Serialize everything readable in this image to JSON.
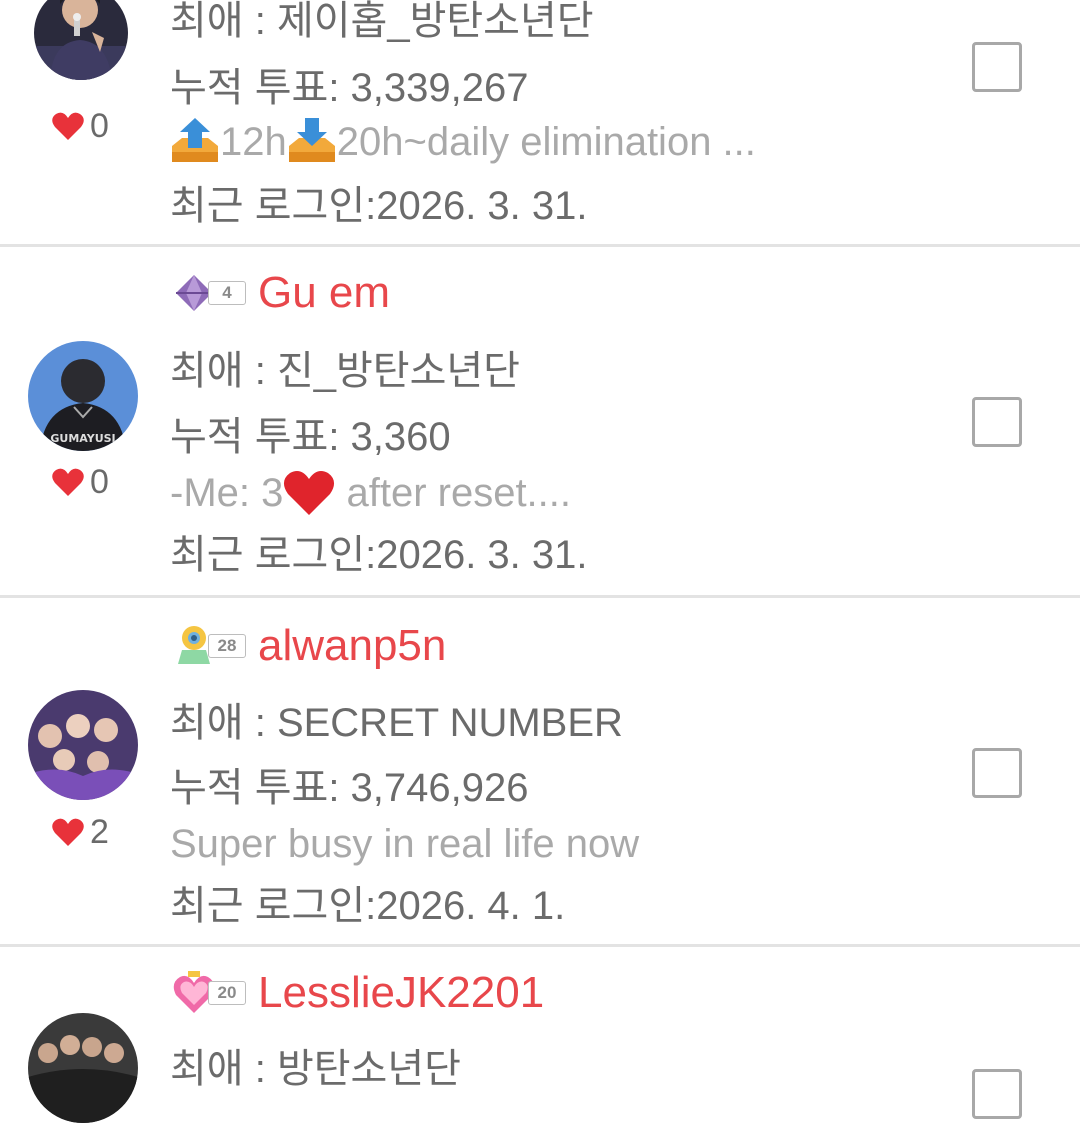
{
  "entries": [
    {
      "username": "",
      "level": "",
      "fav_line": "최애 : 제이홉_방탄소년단",
      "votes_line": "누적 투표: 3,339,267",
      "status_parts": [
        "12h",
        "20h~daily elimination ..."
      ],
      "login_line": "최근 로그인:2026. 3. 31.",
      "likes": "0",
      "checked": false,
      "avatar_icon": "avatar-singer-icon"
    },
    {
      "username": "Gu em",
      "level": "4",
      "badge_icon": "purple-gem-icon",
      "fav_line": "최애 : 진_방탄소년단",
      "votes_line": "누적 투표: 3,360",
      "status_parts": [
        "-Me: 3",
        " after reset...."
      ],
      "login_line": "최근 로그인:2026. 3. 31.",
      "likes": "0",
      "checked": false,
      "avatar_icon": "avatar-gumayusi-icon"
    },
    {
      "username": "alwanp5n",
      "level": "28",
      "badge_icon": "sunflower-crown-icon",
      "fav_line": "최애 : SECRET NUMBER",
      "votes_line": "누적 투표: 3,746,926",
      "status": "Super busy in real life now",
      "login_line": "최근 로그인:2026. 4. 1.",
      "likes": "2",
      "checked": false,
      "avatar_icon": "avatar-group-photo-icon"
    },
    {
      "username": "LesslieJK2201",
      "level": "20",
      "badge_icon": "pink-heart-badge-icon",
      "fav_line": "최애 : 방탄소년단",
      "checked": false,
      "avatar_icon": "avatar-band-photo-icon"
    }
  ],
  "colors": {
    "username": "#e8474b",
    "heart": "#e8323a",
    "text": "#6b6b6b",
    "muted": "#a9a9a9",
    "divider": "#e3e3e3",
    "checkbox_border": "#a8a8a8"
  }
}
